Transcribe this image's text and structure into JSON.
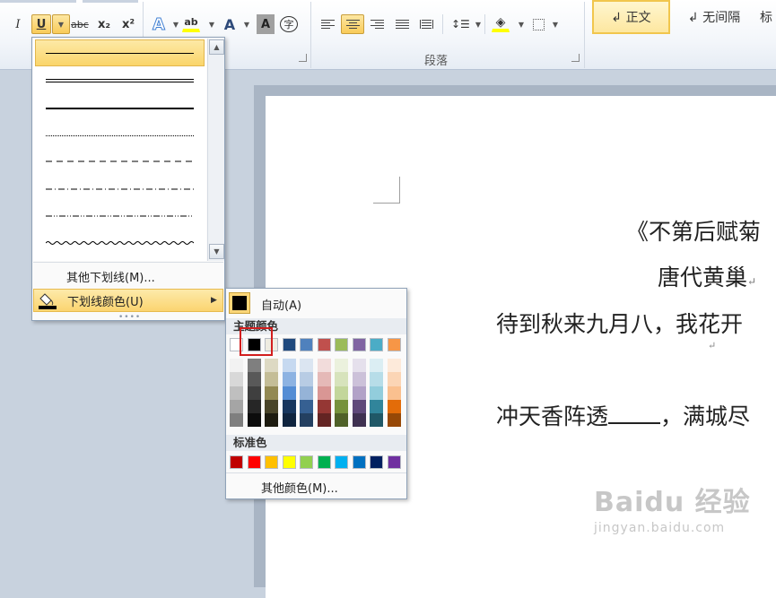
{
  "ribbon": {
    "font_buttons": {
      "italic": "I",
      "underline": "U",
      "strikethrough": "abc",
      "subscript": "x₂",
      "superscript": "x²",
      "text_effect": "A",
      "highlight": "ab",
      "font_color": "A",
      "char_shading": "A",
      "enclose_char": "字"
    },
    "paragraph_group_label": "段落",
    "styles": [
      {
        "label": "↲ 正文",
        "selected": true
      },
      {
        "label": "↲ 无间隔",
        "selected": false
      },
      {
        "label": "标",
        "selected": false
      }
    ]
  },
  "underline_menu": {
    "styles": [
      "single",
      "double",
      "thick",
      "dotted",
      "dashed",
      "dash-dot",
      "dash-dot-dot",
      "wave"
    ],
    "selected_style": "single",
    "more_underlines": "其他下划线(M)...",
    "underline_color": "下划线颜色(U)"
  },
  "color_menu": {
    "auto": "自动(A)",
    "theme_colors_title": "主题颜色",
    "standard_colors_title": "标准色",
    "more_colors": "其他颜色(M)...",
    "theme_top": [
      "#FFFFFF",
      "#000000",
      "#EEECE1",
      "#1F497D",
      "#4F81BD",
      "#C0504D",
      "#9BBB59",
      "#8064A2",
      "#4BACC6",
      "#F79646"
    ],
    "theme_shades": [
      [
        "#F2F2F2",
        "#D8D8D8",
        "#BFBFBF",
        "#A5A5A5",
        "#7F7F7F"
      ],
      [
        "#7F7F7F",
        "#595959",
        "#3F3F3F",
        "#262626",
        "#0C0C0C"
      ],
      [
        "#DDD9C3",
        "#C4BD97",
        "#938953",
        "#494429",
        "#1D1B10"
      ],
      [
        "#C6D9F0",
        "#8DB3E2",
        "#548DD4",
        "#17365D",
        "#0F243E"
      ],
      [
        "#DBE5F1",
        "#B8CCE4",
        "#95B3D7",
        "#366092",
        "#244061"
      ],
      [
        "#F2DCDB",
        "#E5B9B7",
        "#D99694",
        "#953734",
        "#632423"
      ],
      [
        "#EBF1DD",
        "#D7E3BC",
        "#C3D69B",
        "#76923C",
        "#4F6128"
      ],
      [
        "#E5E0EC",
        "#CCC1D9",
        "#B2A2C7",
        "#5F497A",
        "#3F3151"
      ],
      [
        "#DBEEF3",
        "#B7DDE8",
        "#92CDDC",
        "#31859B",
        "#205867"
      ],
      [
        "#FDEADA",
        "#FBD5B5",
        "#FAC08F",
        "#E36C09",
        "#974806"
      ]
    ],
    "standard": [
      "#C00000",
      "#FF0000",
      "#FFC000",
      "#FFFF00",
      "#92D050",
      "#00B050",
      "#00B0F0",
      "#0070C0",
      "#002060",
      "#7030A0"
    ],
    "selected_color": "#000000"
  },
  "document": {
    "line1": "《不第后赋菊",
    "line2": "唐代黄巢",
    "line3": "待到秋来九月八，我花开",
    "line4_before": "冲天香阵透",
    "line4_after": "，满城尽"
  },
  "watermark": {
    "main": "Baidu 经验",
    "sub": "jingyan.baidu.com"
  }
}
